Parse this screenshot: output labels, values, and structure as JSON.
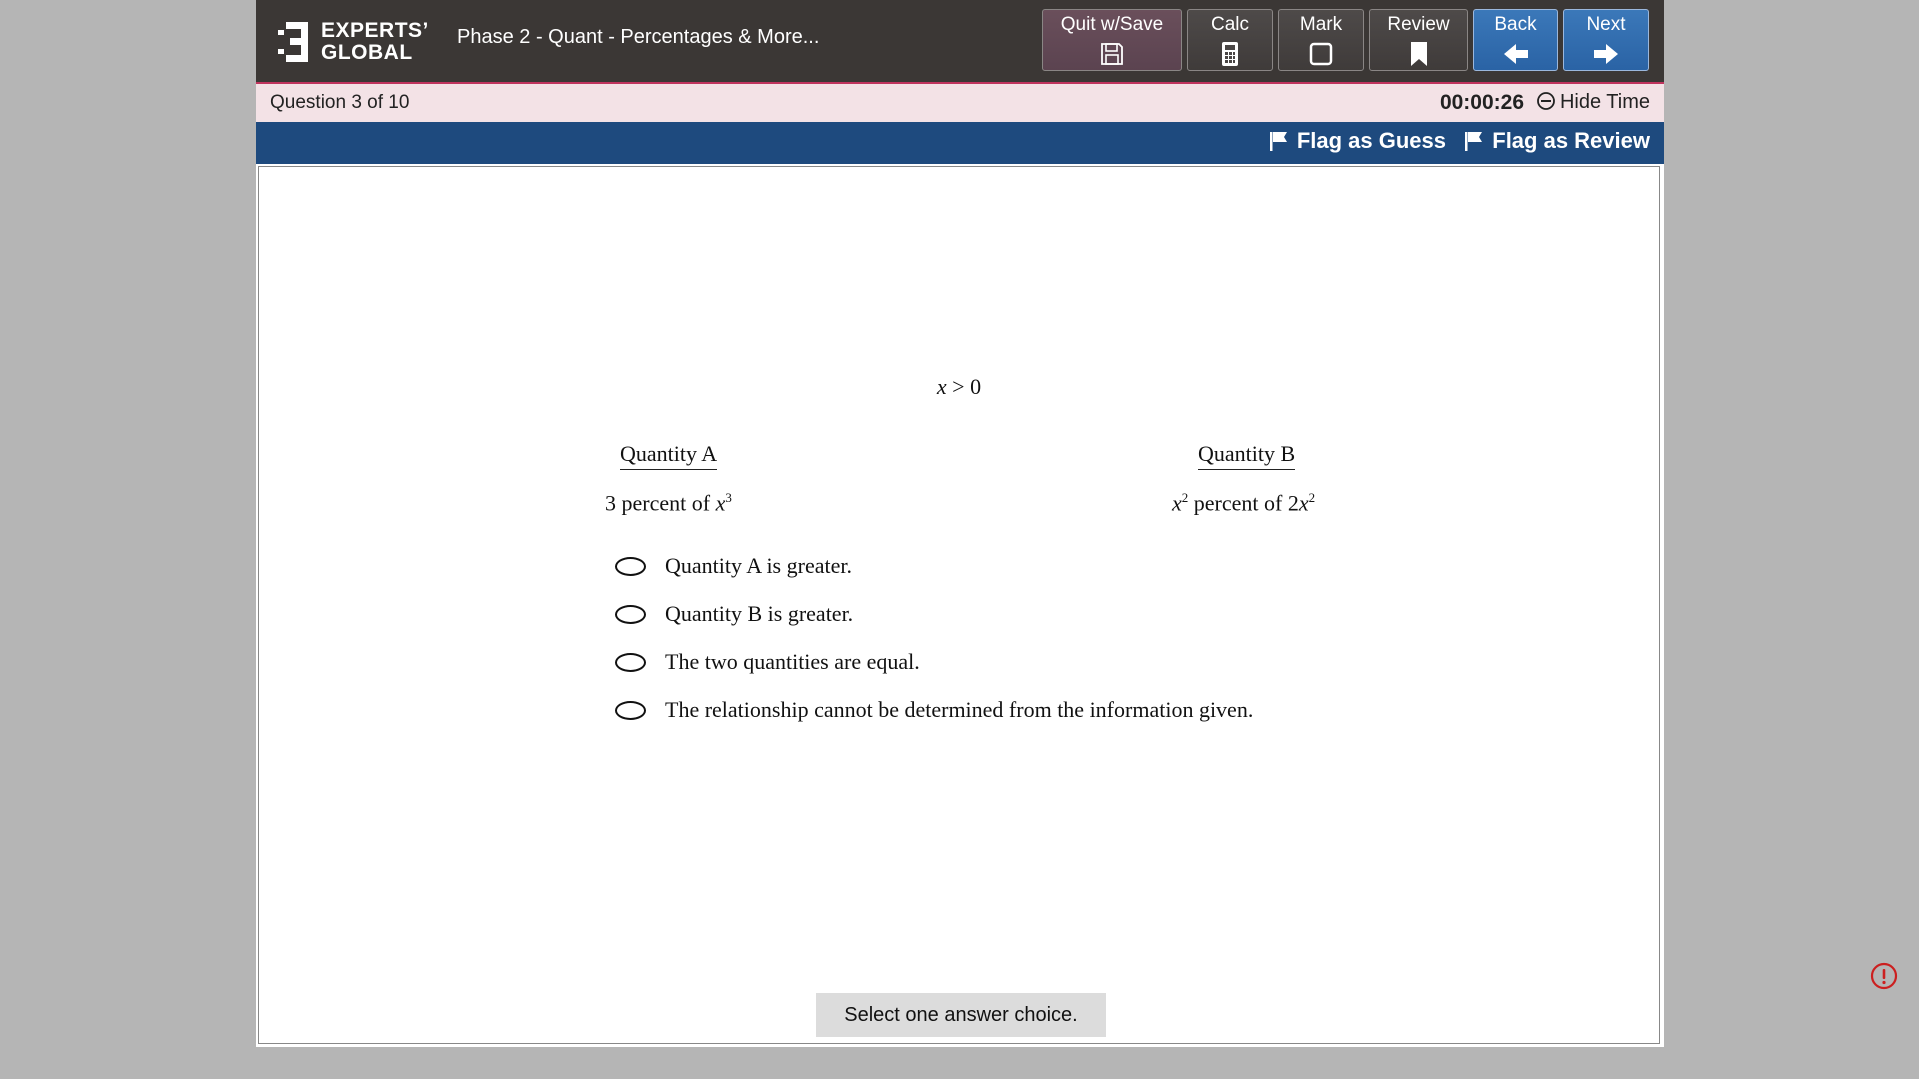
{
  "header": {
    "logo_line1": "EXPERTS’",
    "logo_line2": "GLOBAL",
    "exam_title": "Phase 2 - Quant - Percentages & More...",
    "buttons": {
      "quit": "Quit w/Save",
      "calc": "Calc",
      "mark": "Mark",
      "review": "Review",
      "back": "Back",
      "next": "Next"
    }
  },
  "question_bar": {
    "question_label": "Question 3 of 10",
    "timer": "00:00:26",
    "hide_time": "Hide Time"
  },
  "flag_bar": {
    "flag_guess": "Flag as Guess",
    "flag_review": "Flag as Review"
  },
  "question": {
    "condition_var": "x",
    "condition_rest": " > 0",
    "quantity_a_label": "Quantity A",
    "quantity_b_label": "Quantity B",
    "quantity_a_prefix": "3 percent of ",
    "quantity_a_var": "x",
    "quantity_a_exp": "3",
    "quantity_b_var1": "x",
    "quantity_b_exp1": "2",
    "quantity_b_mid": " percent of 2",
    "quantity_b_var2": "x",
    "quantity_b_exp2": "2",
    "choices": [
      "Quantity A is greater.",
      "Quantity B is greater.",
      "The two quantities are equal.",
      "The relationship cannot be determined from the information given."
    ],
    "instruction": "Select one answer choice."
  },
  "colors": {
    "header_bg": "#3b3735",
    "accent_line": "#c0345e",
    "question_bar_bg": "#f3e2e6",
    "flag_bar_bg": "#1e4a7e",
    "nav_button": "#2a63a5",
    "alert": "#cc1f1f"
  },
  "icons": {
    "quit": "save-icon",
    "calc": "calculator-icon",
    "mark": "checkbox-icon",
    "review": "bookmark-icon",
    "back": "arrow-left-icon",
    "next": "arrow-right-icon",
    "hide_time": "minus-circle-icon",
    "flag": "flag-icon",
    "alert": "exclamation-circle-icon"
  }
}
